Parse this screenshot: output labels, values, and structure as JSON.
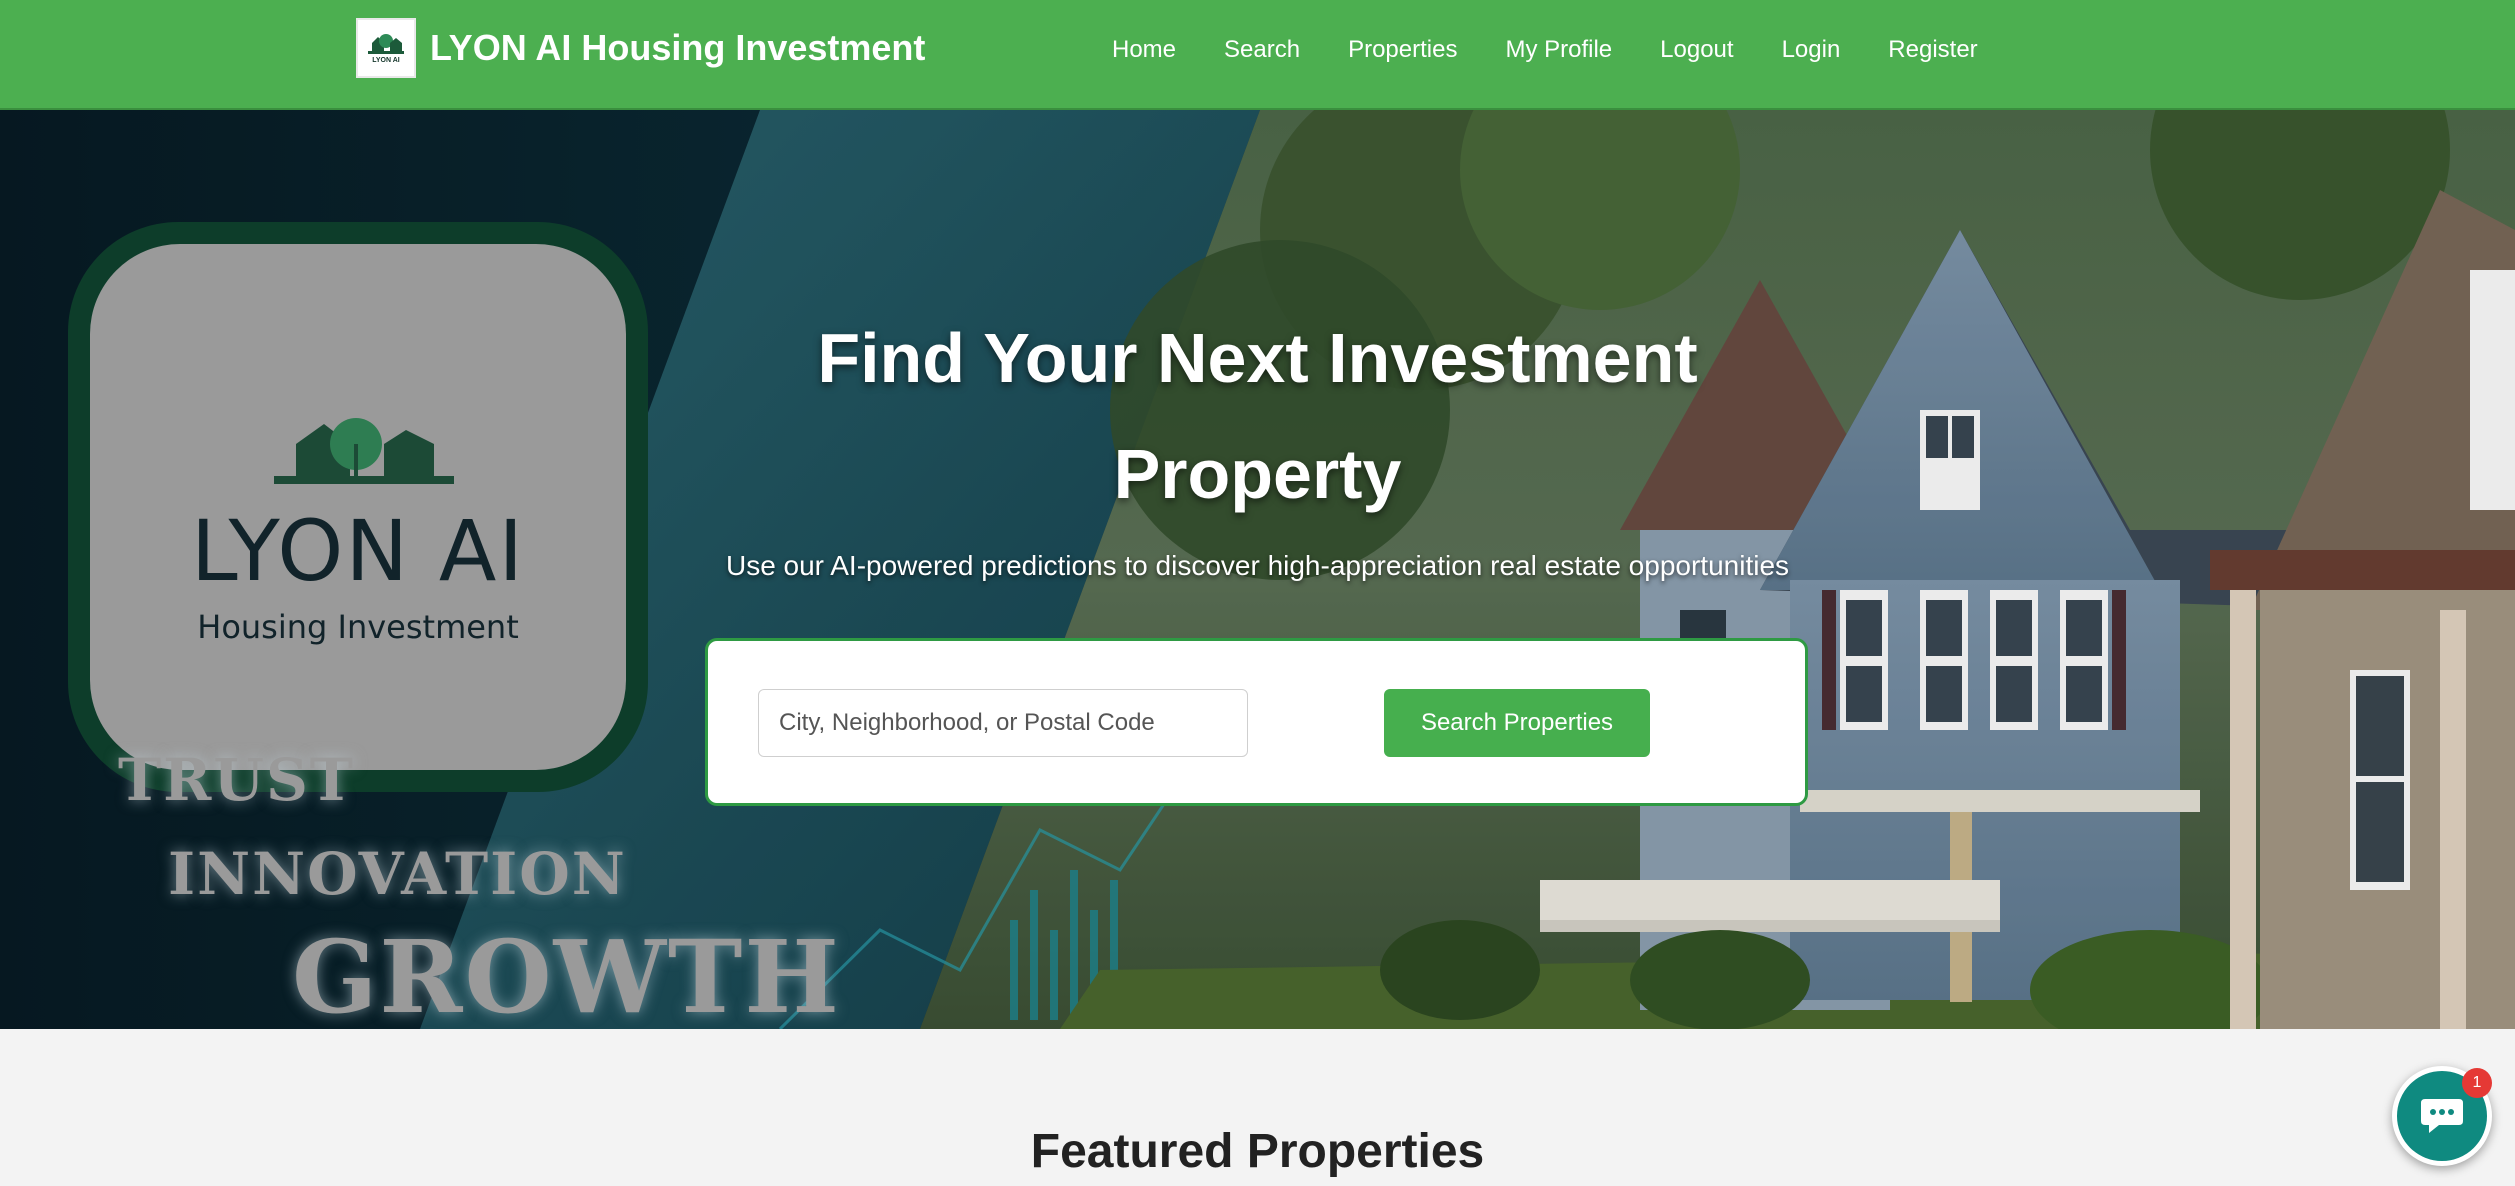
{
  "brand": {
    "logo_text": "LYON AI",
    "title": "LYON AI Housing Investment"
  },
  "nav": {
    "items": [
      {
        "label": "Home"
      },
      {
        "label": "Search"
      },
      {
        "label": "Properties"
      },
      {
        "label": "My Profile"
      },
      {
        "label": "Logout"
      },
      {
        "label": "Login"
      },
      {
        "label": "Register"
      }
    ]
  },
  "hero": {
    "logo_tile": {
      "name": "LYON AI",
      "subtitle": "Housing Investment"
    },
    "words": {
      "trust": "TRUST",
      "innovation": "INNOVATION",
      "growth": "GROWTH"
    },
    "title": "Find Your Next Investment Property",
    "subtitle": "Use our AI-powered predictions to discover high-appreciation real estate opportunities",
    "search": {
      "placeholder": "City, Neighborhood, or Postal Code",
      "value": "",
      "button_label": "Search Properties"
    }
  },
  "featured": {
    "title": "Featured Properties"
  },
  "chat": {
    "badge_count": "1"
  },
  "colors": {
    "nav_green": "#4caf50",
    "button_green": "#46af4e",
    "card_border": "#2e9a43",
    "chat_teal": "#0f8a80",
    "badge_red": "#e53935"
  },
  "icons": [
    "house-logo-icon",
    "chat-bubble-icon"
  ]
}
